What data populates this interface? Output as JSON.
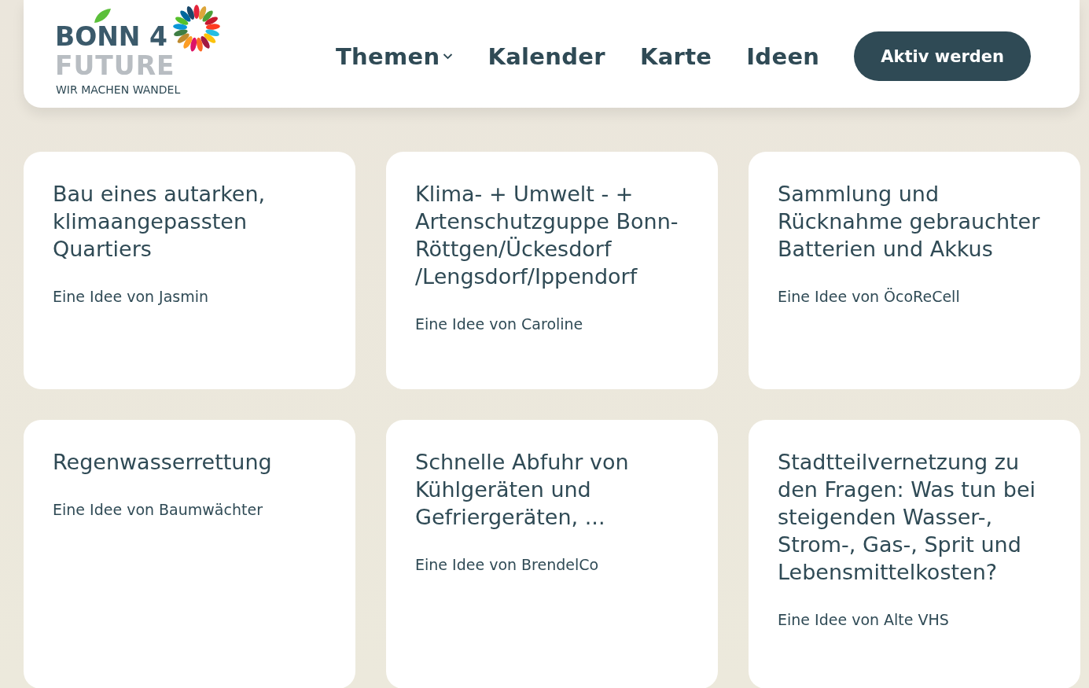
{
  "logo": {
    "line_1": "BONN 4",
    "line_2": "FUTURE",
    "tagline": "WIR MACHEN WANDEL"
  },
  "nav": {
    "items": [
      {
        "label": "Themen",
        "kind": "dropdown"
      },
      {
        "label": "Kalender",
        "kind": "link"
      },
      {
        "label": "Karte",
        "kind": "link"
      },
      {
        "label": "Ideen",
        "kind": "link"
      }
    ],
    "cta": "Aktiv werden"
  },
  "ideas": [
    {
      "title": "Bau eines autarken, klimaangepassten Quartiers",
      "byline": "Eine Idee von Jasmin"
    },
    {
      "title": "Klima- + Umwelt - + Artenschutzguppe Bonn-Röttgen/Ückesdorf /Lengsdorf/Ippendorf",
      "byline": "Eine Idee von Caroline"
    },
    {
      "title": "Sammlung und Rücknahme gebrauchter Batterien und Akkus",
      "byline": "Eine Idee von ÖcoReCell"
    },
    {
      "title": "Regenwasserrettung",
      "byline": "Eine Idee von Baumwächter"
    },
    {
      "title": "Schnelle Abfuhr von Kühlgeräten und Gefriergeräten, ...",
      "byline": "Eine Idee von BrendelCo"
    },
    {
      "title": "Stadtteilvernetzung zu den Fragen: Was tun bei steigenden Wasser-, Strom-, Gas-, Sprit und Lebensmittelkosten?",
      "byline": "Eine Idee von Alte VHS"
    }
  ]
}
